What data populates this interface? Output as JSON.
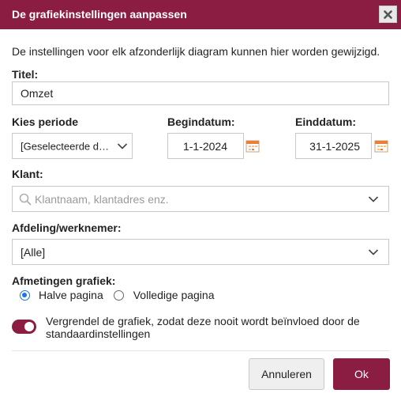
{
  "dialog": {
    "title": "De grafiekinstellingen aanpassen",
    "close_icon": "close-icon",
    "intro": "De instellingen voor elk afzonderlijk diagram kunnen hier worden gewijzigd."
  },
  "title_field": {
    "label": "Titel:",
    "value": "Omzet"
  },
  "period": {
    "label": "Kies periode",
    "value": "[Geselecteerde d…"
  },
  "start_date": {
    "label": "Begindatum:",
    "value": "1-1-2024"
  },
  "end_date": {
    "label": "Einddatum:",
    "value": "31-1-2025"
  },
  "client": {
    "label": "Klant:",
    "placeholder": "Klantnaam, klantadres enz."
  },
  "department": {
    "label": "Afdeling/werknemer:",
    "value": "[Alle]"
  },
  "chart_size": {
    "label": "Afmetingen grafiek:",
    "options": [
      "Halve pagina",
      "Volledige pagina"
    ],
    "selected": "Halve pagina"
  },
  "lock": {
    "label": "Vergrendel de grafiek, zodat deze nooit wordt beïnvloed door de standaardinstellingen",
    "enabled": true
  },
  "buttons": {
    "cancel": "Annuleren",
    "ok": "Ok"
  },
  "colors": {
    "brand": "#8b1d42",
    "radio_accent": "#1a73e8"
  }
}
